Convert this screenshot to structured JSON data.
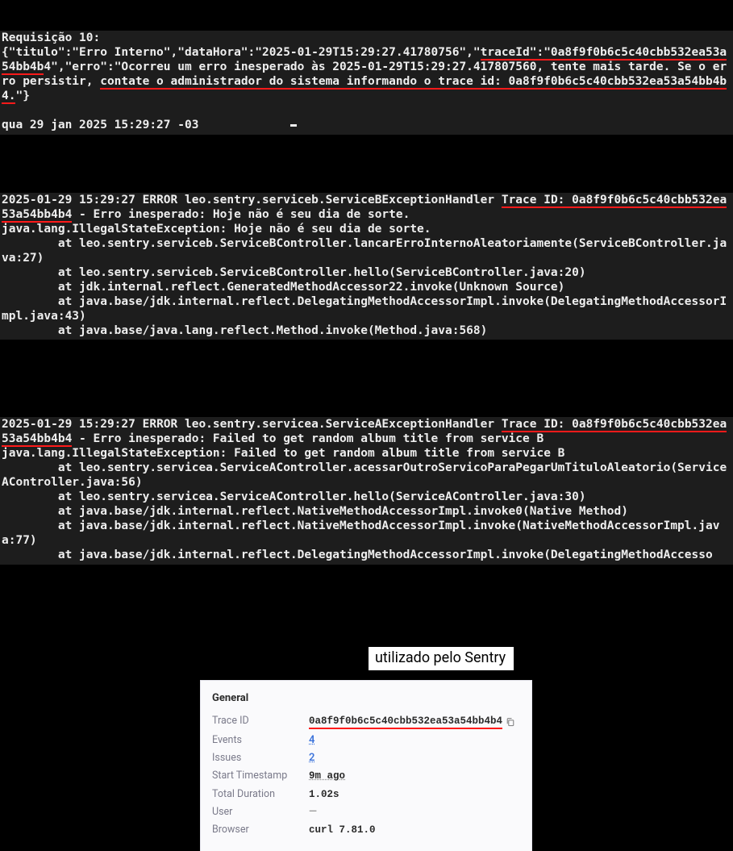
{
  "terminal1": {
    "seg1": "Requisição 10:\n{\"titulo\":\"Erro Interno\",\"dataHora\":\"2025-01-29T15:29:27.41780756\",\"",
    "ul1": "traceId\":\"0a8f9f0b6c5c40cbb532ea53a54bb4b",
    "seg2": "4\",\"erro\":\"Ocorreu um erro inesperado às 2025-01-29T15:29:27.417807560, tente mais tarde. Se o erro persistir, ",
    "ul2": "contate o administrador do sistema informando o trace id: 0a8f9f0b6c5c40cbb532ea53a54bb4b4.",
    "seg3": "\"}\n\nqua 29 jan 2025 15:29:27 -03             "
  },
  "terminal2": {
    "ts": "2025-01-29 15:29:27 ",
    "err": "ERROR",
    "seg1": " leo.sentry.serviceb.ServiceBExceptionHandler ",
    "ul1": "Trace ID: 0a8f9f0b6c5c40cbb532ea53a54bb4b4",
    "seg2": " - Erro inesperado: Hoje não é seu dia de sorte.\njava.lang.IllegalStateException: Hoje não é seu dia de sorte.\n        at leo.sentry.serviceb.ServiceBController.lancarErroInternoAleatoriamente(ServiceBController.java:27)\n        at leo.sentry.serviceb.ServiceBController.hello(ServiceBController.java:20)\n        at jdk.internal.reflect.GeneratedMethodAccessor22.invoke(Unknown Source)\n        at java.base/jdk.internal.reflect.DelegatingMethodAccessorImpl.invoke(DelegatingMethodAccessorImpl.java:43)\n        at java.base/java.lang.reflect.Method.invoke(Method.java:568)"
  },
  "terminal3": {
    "ts": "2025-01-29 15:29:27 ",
    "err": "ERROR",
    "seg1": " leo.sentry.servicea.ServiceAExceptionHandler ",
    "ul1": "Trace ID: 0a8f9f0b6c5c40cbb532ea53a54bb4b4",
    "seg2": " - Erro inesperado: Failed to get random album title from service B\njava.lang.IllegalStateException: Failed to get random album title from service B\n        at leo.sentry.servicea.ServiceAController.acessarOutroServicoParaPegarUmTituloAleatorio(ServiceAController.java:56)\n        at leo.sentry.servicea.ServiceAController.hello(ServiceAController.java:30)\n        at java.base/jdk.internal.reflect.NativeMethodAccessorImpl.invoke0(Native Method)\n        at java.base/jdk.internal.reflect.NativeMethodAccessorImpl.invoke(NativeMethodAccessorImpl.java:77)\n        at java.base/jdk.internal.reflect.DelegatingMethodAccessorImpl.invoke(DelegatingMethodAccesso"
  },
  "caption": "utilizado pelo Sentry",
  "sentry": {
    "heading": "General",
    "rows": {
      "trace_label": "Trace ID",
      "trace_value": "0a8f9f0b6c5c40cbb532ea53a54bb4b4",
      "events_label": "Events",
      "events_value": "4",
      "issues_label": "Issues",
      "issues_value": "2",
      "start_label": "Start Timestamp",
      "start_value": "9m ago",
      "duration_label": "Total Duration",
      "duration_value": "1.02s",
      "user_label": "User",
      "user_value": "—",
      "browser_label": "Browser",
      "browser_value": "curl 7.81.0"
    }
  }
}
